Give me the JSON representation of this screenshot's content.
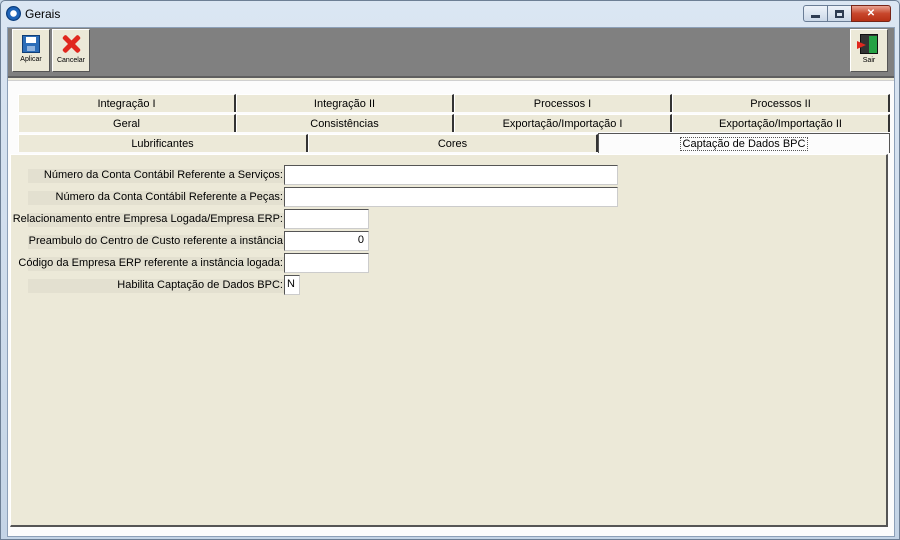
{
  "window": {
    "title": "Gerais",
    "min_glyph": "",
    "max_glyph": "",
    "close_glyph": "✕"
  },
  "toolbar": {
    "aplicar_label": "Aplicar",
    "cancelar_label": "Cancelar",
    "sair_label": "Sair"
  },
  "tabs": {
    "row1": [
      "Integração I",
      "Integração II",
      "Processos I",
      "Processos II"
    ],
    "row2": [
      "Geral",
      "Consistências",
      "Exportação/Importação I",
      "Exportação/Importação II"
    ],
    "row3": [
      "Lubrificantes",
      "Cores",
      "Captação de Dados BPC"
    ],
    "active": "Captação de Dados BPC"
  },
  "form": {
    "fields": [
      {
        "label": "Número da Conta Contábil Referente a Serviços:",
        "value": ""
      },
      {
        "label": "Número da Conta Contábil Referente a Peças:",
        "value": ""
      },
      {
        "label": "Relacionamento entre Empresa Logada/Empresa ERP:",
        "value": ""
      },
      {
        "label": "Preambulo do Centro de Custo referente a instância",
        "value": "0"
      },
      {
        "label": "Código da Empresa ERP referente a instância logada:",
        "value": ""
      },
      {
        "label": "Habilita Captação de Dados BPC:",
        "value": "N"
      }
    ]
  },
  "colors": {
    "toolbar_bg": "#808080",
    "panel_bg": "#ece9d8",
    "close_red": "#c8472c"
  }
}
